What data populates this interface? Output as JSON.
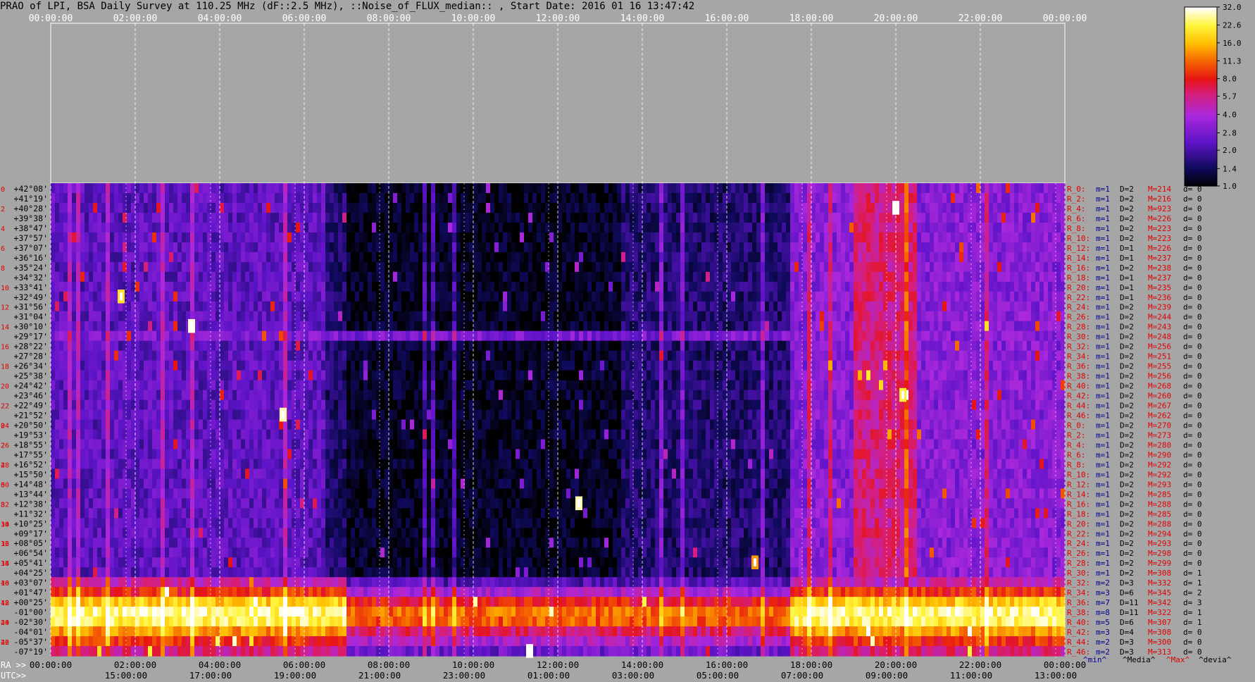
{
  "title": "PRAO of LPI, BSA Daily Survey at 110.25 MHz (dF::2.5 MHz), ::Noise_of_FLUX_median:: , Start Date: 2016 01 16 13:47:42",
  "chart_data": {
    "type": "heatmap",
    "top_time_ticks": [
      "00:00:00",
      "02:00:00",
      "04:00:00",
      "06:00:00",
      "08:00:00",
      "10:00:00",
      "12:00:00",
      "14:00:00",
      "16:00:00",
      "18:00:00",
      "20:00:00",
      "22:00:00",
      "00:00:00"
    ],
    "ra_prefix": "RA >>",
    "ra_ticks": [
      "00:00:00",
      "02:00:00",
      "04:00:00",
      "06:00:00",
      "08:00:00",
      "10:00:00",
      "12:00:00",
      "14:00:00",
      "16:00:00",
      "18:00:00",
      "20:00:00",
      "22:00:00",
      "00:00:00"
    ],
    "utc_prefix": "UTC>>",
    "utc_ticks": [
      "15:00:00",
      "17:00:00",
      "19:00:00",
      "21:00:00",
      "23:00:00",
      "01:00:00",
      "03:00:00",
      "05:00:00",
      "07:00:00",
      "09:00:00",
      "11:00:00",
      "13:00:00"
    ],
    "declinations": [
      "+42°08'",
      "+41°19'",
      "+40°28'",
      "+39°38'",
      "+38°47'",
      "+37°57'",
      "+37°07'",
      "+36°16'",
      "+35°24'",
      "+34°32'",
      "+33°41'",
      "+32°49'",
      "+31°56'",
      "+31°04'",
      "+30°10'",
      "+29°17'",
      "+28°22'",
      "+27°28'",
      "+26°34'",
      "+25°38'",
      "+24°42'",
      "+23°46'",
      "+22°49'",
      "+21°52'",
      "+20°50'",
      "+19°53'",
      "+18°55'",
      "+17°55'",
      "+16°52'",
      "+15°50'",
      "+14°48'",
      "+13°44'",
      "+12°38'",
      "+11°32'",
      "+10°25'",
      "+09°17'",
      "+08°05'",
      "+06°54'",
      "+05°41'",
      "+04°25'",
      "+03°07'",
      "+01°47'",
      "+00°25'",
      "-01°00'",
      "-02°30'",
      "-04°01'",
      "-05°37'",
      "-07°19'"
    ],
    "left_row_numbers": [
      "0",
      "2",
      "4",
      "6",
      "8",
      "10",
      "12",
      "14",
      "16",
      "18",
      "20",
      "22",
      "24",
      "26",
      "28",
      "30",
      "32",
      "34",
      "36",
      "38",
      "40",
      "42",
      "44",
      "46"
    ],
    "right_stats": [
      {
        "r": "R_0:",
        "m": "m=1",
        "D": "D=2",
        "M": "M=214",
        "d": "d= 0"
      },
      {
        "r": "R_2:",
        "m": "m=1",
        "D": "D=2",
        "M": "M=216",
        "d": "d= 0"
      },
      {
        "r": "R_4:",
        "m": "m=1",
        "D": "D=2",
        "M": "M=923",
        "d": "d= 0"
      },
      {
        "r": "R_6:",
        "m": "m=1",
        "D": "D=2",
        "M": "M=226",
        "d": "d= 0"
      },
      {
        "r": "R_8:",
        "m": "m=1",
        "D": "D=2",
        "M": "M=223",
        "d": "d= 0"
      },
      {
        "r": "R_10:",
        "m": "m=1",
        "D": "D=2",
        "M": "M=223",
        "d": "d= 0"
      },
      {
        "r": "R_12:",
        "m": "m=1",
        "D": "D=1",
        "M": "M=226",
        "d": "d= 0"
      },
      {
        "r": "R_14:",
        "m": "m=1",
        "D": "D=1",
        "M": "M=237",
        "d": "d= 0"
      },
      {
        "r": "R_16:",
        "m": "m=1",
        "D": "D=2",
        "M": "M=238",
        "d": "d= 0"
      },
      {
        "r": "R_18:",
        "m": "m=1",
        "D": "D=1",
        "M": "M=237",
        "d": "d= 0"
      },
      {
        "r": "R_20:",
        "m": "m=1",
        "D": "D=1",
        "M": "M=235",
        "d": "d= 0"
      },
      {
        "r": "R_22:",
        "m": "m=1",
        "D": "D=1",
        "M": "M=236",
        "d": "d= 0"
      },
      {
        "r": "R_24:",
        "m": "m=1",
        "D": "D=2",
        "M": "M=239",
        "d": "d= 0"
      },
      {
        "r": "R_26:",
        "m": "m=1",
        "D": "D=2",
        "M": "M=244",
        "d": "d= 0"
      },
      {
        "r": "R_28:",
        "m": "m=1",
        "D": "D=2",
        "M": "M=243",
        "d": "d= 0"
      },
      {
        "r": "R_30:",
        "m": "m=1",
        "D": "D=2",
        "M": "M=248",
        "d": "d= 0"
      },
      {
        "r": "R_32:",
        "m": "m=1",
        "D": "D=2",
        "M": "M=256",
        "d": "d= 0"
      },
      {
        "r": "R_34:",
        "m": "m=1",
        "D": "D=2",
        "M": "M=251",
        "d": "d= 0"
      },
      {
        "r": "R_36:",
        "m": "m=1",
        "D": "D=2",
        "M": "M=255",
        "d": "d= 0"
      },
      {
        "r": "R_38:",
        "m": "m=1",
        "D": "D=2",
        "M": "M=256",
        "d": "d= 0"
      },
      {
        "r": "R_40:",
        "m": "m=1",
        "D": "D=2",
        "M": "M=268",
        "d": "d= 0"
      },
      {
        "r": "R_42:",
        "m": "m=1",
        "D": "D=2",
        "M": "M=260",
        "d": "d= 0"
      },
      {
        "r": "R_44:",
        "m": "m=1",
        "D": "D=2",
        "M": "M=267",
        "d": "d= 0"
      },
      {
        "r": "R_46:",
        "m": "m=1",
        "D": "D=2",
        "M": "M=262",
        "d": "d= 0"
      },
      {
        "r": "R_0:",
        "m": "m=1",
        "D": "D=2",
        "M": "M=270",
        "d": "d= 0"
      },
      {
        "r": "R_2:",
        "m": "m=1",
        "D": "D=2",
        "M": "M=273",
        "d": "d= 0"
      },
      {
        "r": "R_4:",
        "m": "m=1",
        "D": "D=2",
        "M": "M=280",
        "d": "d= 0"
      },
      {
        "r": "R_6:",
        "m": "m=1",
        "D": "D=2",
        "M": "M=290",
        "d": "d= 0"
      },
      {
        "r": "R_8:",
        "m": "m=1",
        "D": "D=2",
        "M": "M=292",
        "d": "d= 0"
      },
      {
        "r": "R_10:",
        "m": "m=1",
        "D": "D=2",
        "M": "M=292",
        "d": "d= 0"
      },
      {
        "r": "R_12:",
        "m": "m=1",
        "D": "D=2",
        "M": "M=293",
        "d": "d= 0"
      },
      {
        "r": "R_14:",
        "m": "m=1",
        "D": "D=2",
        "M": "M=285",
        "d": "d= 0"
      },
      {
        "r": "R_16:",
        "m": "m=1",
        "D": "D=2",
        "M": "M=288",
        "d": "d= 0"
      },
      {
        "r": "R_18:",
        "m": "m=1",
        "D": "D=2",
        "M": "M=285",
        "d": "d= 0"
      },
      {
        "r": "R_20:",
        "m": "m=1",
        "D": "D=2",
        "M": "M=288",
        "d": "d= 0"
      },
      {
        "r": "R_22:",
        "m": "m=1",
        "D": "D=2",
        "M": "M=294",
        "d": "d= 0"
      },
      {
        "r": "R_24:",
        "m": "m=1",
        "D": "D=2",
        "M": "M=293",
        "d": "d= 0"
      },
      {
        "r": "R_26:",
        "m": "m=1",
        "D": "D=2",
        "M": "M=298",
        "d": "d= 0"
      },
      {
        "r": "R_28:",
        "m": "m=1",
        "D": "D=2",
        "M": "M=299",
        "d": "d= 0"
      },
      {
        "r": "R_30:",
        "m": "m=1",
        "D": "D=2",
        "M": "M=308",
        "d": "d= 1"
      },
      {
        "r": "R_32:",
        "m": "m=2",
        "D": "D=3",
        "M": "M=332",
        "d": "d= 1"
      },
      {
        "r": "R_34:",
        "m": "m=3",
        "D": "D=6",
        "M": "M=345",
        "d": "d= 2"
      },
      {
        "r": "R_36:",
        "m": "m=7",
        "D": "D=11",
        "M": "M=342",
        "d": "d= 3"
      },
      {
        "r": "R_38:",
        "m": "m=8",
        "D": "D=11",
        "M": "M=322",
        "d": "d= 1"
      },
      {
        "r": "R_40:",
        "m": "m=5",
        "D": "D=6",
        "M": "M=307",
        "d": "d= 1"
      },
      {
        "r": "R_42:",
        "m": "m=3",
        "D": "D=4",
        "M": "M=308",
        "d": "d= 0"
      },
      {
        "r": "R_44:",
        "m": "m=2",
        "D": "D=3",
        "M": "M=300",
        "d": "d= 0"
      },
      {
        "r": "R_46:",
        "m": "m=2",
        "D": "D=3",
        "M": "M=313",
        "d": "d= 0"
      }
    ],
    "footer_legend": [
      "^min^",
      "^Media^",
      "^Max^",
      "^devia^"
    ],
    "colorbar_ticks": [
      "32.0",
      "22.6",
      "16.0",
      "11.3",
      "8.0",
      "5.7",
      "4.0",
      "2.8",
      "2.0",
      "1.4",
      "1.0"
    ],
    "colorbar_scale": "log",
    "colorbar_range": [
      1.0,
      32.0
    ],
    "grid": true,
    "colors": {
      "background": "#a6a6a6",
      "label_red": "#e00000",
      "label_blue": "#000090",
      "label_black": "#000000",
      "grid_line": "#ffffff"
    },
    "value_model": {
      "base_level": 1.6,
      "broad_regions": [
        {
          "x_from": "00:00:00",
          "x_to": "06:30:00",
          "dec_from": "+42°08'",
          "dec_to": "+04°25'",
          "level": 2.4
        },
        {
          "x_from": "07:00:00",
          "x_to": "13:30:00",
          "dec_from": "+42°08'",
          "dec_to": "+04°25'",
          "level": 1.15
        },
        {
          "x_from": "17:30:00",
          "x_to": "24:00:00",
          "dec_from": "+42°08'",
          "dec_to": "+04°25'",
          "level": 3.2
        },
        {
          "x_from": "19:00:00",
          "x_to": "20:30:00",
          "dec_from": "+42°08'",
          "dec_to": "+04°25'",
          "level": 6.0
        }
      ],
      "galactic_band": {
        "dec_from": "+03°07'",
        "dec_to": "-07°19'",
        "levels": [
          5.0,
          9.0,
          18.0,
          26.0,
          24.0,
          14.0,
          9.0,
          6.0
        ],
        "dim_x_from": "07:00:00",
        "dim_x_to": "17:30:00",
        "dim_factor": 0.45
      },
      "horizontal_stripe": {
        "dec": "+29°17'",
        "level": 3.0
      },
      "point_sources": [
        {
          "x": "20:00:00",
          "dec": "+40°28'",
          "value": 32
        },
        {
          "x": "03:20:00",
          "dec": "+30°10'",
          "value": 30
        },
        {
          "x": "05:30:00",
          "dec": "+21°52'",
          "value": 28
        },
        {
          "x": "12:30:00",
          "dec": "+12°38'",
          "value": 28
        },
        {
          "x": "01:40:00",
          "dec": "+32°49'",
          "value": 20
        },
        {
          "x": "11:20:00",
          "dec": "-07°19'",
          "value": 32
        },
        {
          "x": "20:10:00",
          "dec": "+23°46'",
          "value": 22
        },
        {
          "x": "16:40:00",
          "dec": "+05°41'",
          "value": 14
        }
      ]
    }
  }
}
